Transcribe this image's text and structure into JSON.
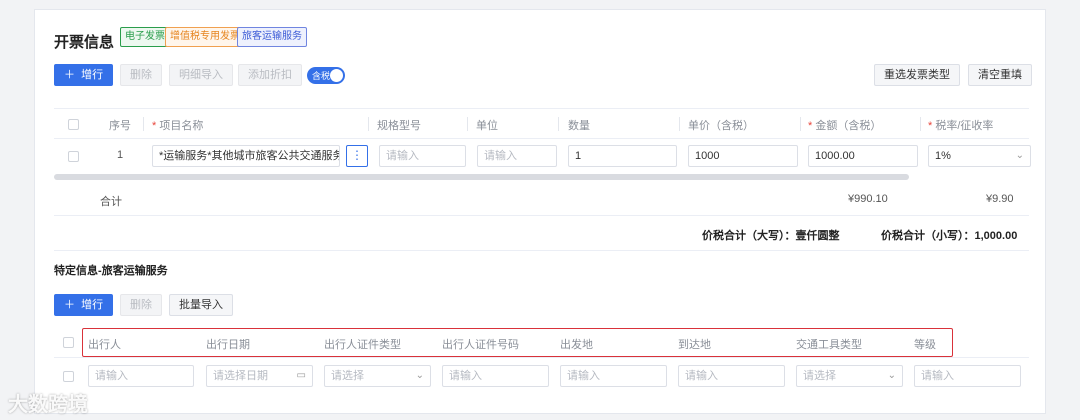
{
  "invoice": {
    "title": "开票信息",
    "tags": {
      "electronic": "电子发票",
      "vat_special": "增值税专用发票",
      "passenger": "旅客运输服务"
    },
    "toolbar": {
      "add_row": "增行",
      "delete": "删除",
      "import_detail": "明细导入",
      "add_discount": "添加折扣",
      "tax_toggle": "含税",
      "reselect_type": "重选发票类型",
      "clear": "清空重填"
    },
    "table": {
      "headers": {
        "index": "序号",
        "item_name": "项目名称",
        "spec": "规格型号",
        "unit": "单位",
        "qty": "数量",
        "price": "单价（含税）",
        "amount": "金额（含税）",
        "tax_rate": "税率/征收率"
      },
      "row": {
        "index": "1",
        "item_name": "*运输服务*其他城市旅客公共交通服务",
        "spec_placeholder": "请输入",
        "unit_placeholder": "请输入",
        "qty": "1",
        "price": "1000",
        "amount": "1000.00",
        "tax_rate": "1%"
      },
      "total": {
        "label": "合计",
        "amount": "¥990.10",
        "tax": "¥9.90"
      }
    },
    "summary": {
      "upper_label": "价税合计（大写）：",
      "upper_value": "壹仟圆整",
      "lower_label": "价税合计（小写）：",
      "lower_value": "1,000.00"
    }
  },
  "special": {
    "title": "特定信息-旅客运输服务",
    "toolbar": {
      "add_row": "增行",
      "delete": "删除",
      "batch_import": "批量导入"
    },
    "headers": [
      "出行人",
      "出行日期",
      "出行人证件类型",
      "出行人证件号码",
      "出发地",
      "到达地",
      "交通工具类型",
      "等级"
    ],
    "row": {
      "traveler": "请输入",
      "date": "请选择日期",
      "id_type": "请选择",
      "id_no": "请输入",
      "from": "请输入",
      "to": "请输入",
      "vehicle": "请选择",
      "grade": "请输入"
    }
  },
  "watermark": "大数跨境",
  "colors": {
    "primary": "#3470e8",
    "required": "#e8443a",
    "highlight_border": "#d9323a"
  }
}
